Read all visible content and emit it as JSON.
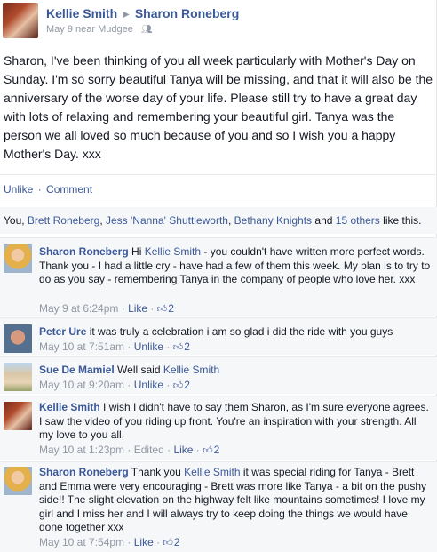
{
  "header": {
    "actor": "Kellie Smith",
    "target": "Sharon Roneberg",
    "arrow": "▶",
    "date": "May 9",
    "location": "near Mudgee",
    "audience_icon": "friends-icon"
  },
  "message": "Sharon, I've been thinking of you all week particularly with Mother's Day on Sunday. I'm so sorry beautiful Tanya will be missing, and that it will also be the anniversary of the worse day of your life. Please still try to have a great day with lots of relaxing and remembering your beautiful girl. Tanya was the person we all loved so much because of you and so I wish you a happy Mother's Day. xxx",
  "actions": {
    "unlike": "Unlike",
    "separator": "·",
    "comment": "Comment"
  },
  "likes": {
    "you": "You",
    "sep1": ", ",
    "name1": "Brett Roneberg",
    "sep2": ", ",
    "name2": "Jess 'Nanna' Shuttleworth",
    "sep3": ", ",
    "name3": "Bethany Knights",
    "and": " and ",
    "others": "15 others",
    "suffix": " like this."
  },
  "comments": [
    {
      "author": "Sharon Roneberg",
      "pre": " Hi ",
      "mention": "Kellie Smith",
      "text": " - you couldn't have written more perfect words. Thank you - I had a little cry - have had a few of them this week. My plan is to try to do as you say - remembering Tanya in the company of people who love her. xxx",
      "time": "May 9 at 6:24pm",
      "sep": " · ",
      "action": "Like",
      "sep2": " · ",
      "like_count": "2"
    },
    {
      "author": "Peter Ure",
      "text": " it was truly a celebration i am so glad i did the ride with you guys",
      "time": "May 10 at 7:51am",
      "sep": " · ",
      "action": "Unlike",
      "sep2": " · ",
      "like_count": "2"
    },
    {
      "author": "Sue De Mamiel",
      "pre": " Well said ",
      "mention": "Kellie Smith",
      "text": "",
      "time": "May 10 at 9:20am",
      "sep": " · ",
      "action": "Unlike",
      "sep2": " · ",
      "like_count": "2"
    },
    {
      "author": "Kellie Smith",
      "text": " I wish I didn't have to say them Sharon, as I'm sure everyone agrees. I saw the video of you riding up front. You're an inspiration with your strength. All my love to you all.",
      "time": "May 10 at 1:23pm",
      "sep": " · ",
      "edited": "Edited",
      "sep3": " · ",
      "action": "Like",
      "sep2": " · ",
      "like_count": "2"
    },
    {
      "author": "Sharon Roneberg",
      "pre": " Thank you ",
      "mention": "Kellie Smith",
      "text": " it was special riding for Tanya - Brett and Emma were very encouraging - Brett was more like Tanya - a bit on the pushy side!! The slight elevation on the highway felt like mountains sometimes! I love my girl and I miss her and I will always try to keep doing the things we would have done together xxx",
      "time": "May 10 at 7:54pm",
      "sep": " · ",
      "action": "Like",
      "sep2": " · ",
      "like_count": "2"
    }
  ],
  "colors": {
    "link": "#3b5998",
    "meta": "#9197a3",
    "comment_bg": "#f6f7f9",
    "text": "#141823"
  },
  "icons": {
    "like": "thumbs-up-icon"
  }
}
